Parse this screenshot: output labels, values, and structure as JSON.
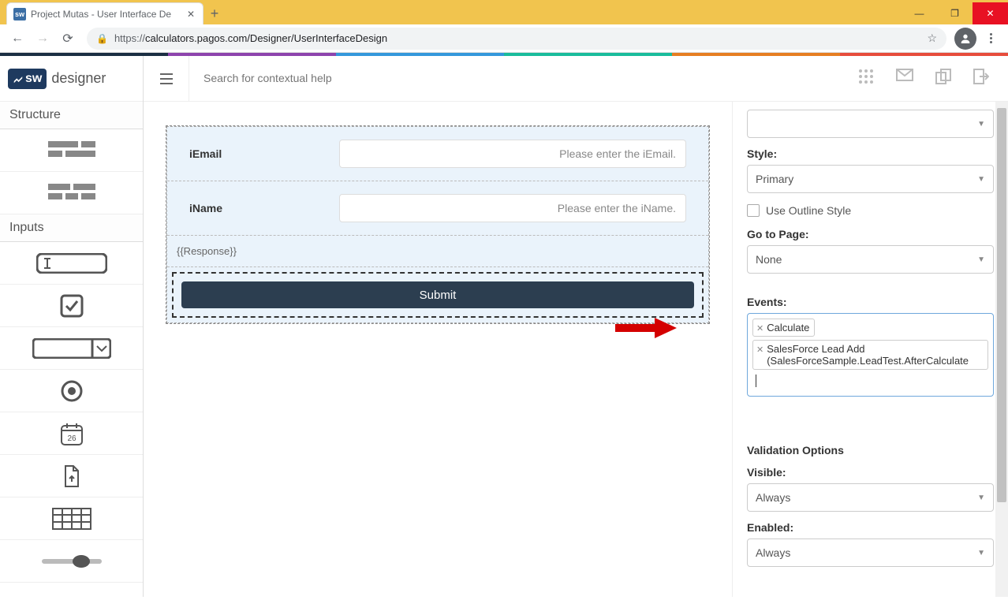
{
  "browser": {
    "tab_title": "Project Mutas - User Interface De",
    "url_proto": "https://",
    "url_rest": "calculators.pagos.com/Designer/UserInterfaceDesign"
  },
  "app": {
    "logo_sw": "sw",
    "logo_text": "designer",
    "search_placeholder": "Search for contextual help"
  },
  "sidebar": {
    "structure_header": "Structure",
    "inputs_header": "Inputs",
    "date_num": "26"
  },
  "form": {
    "iemail_label": "iEmail",
    "iemail_placeholder": "Please enter the iEmail.",
    "iname_label": "iName",
    "iname_placeholder": "Please enter the iName.",
    "response_text": "{{Response}}",
    "submit_label": "Submit"
  },
  "props": {
    "style_label": "Style:",
    "style_value": "Primary",
    "outline_label": "Use Outline Style",
    "gotopage_label": "Go to Page:",
    "gotopage_value": "None",
    "events_label": "Events:",
    "event1": "Calculate",
    "event2_line1": "SalesForce Lead Add",
    "event2_line2": "(SalesForceSample.LeadTest.AfterCalculate",
    "validation_header": "Validation Options",
    "visible_label": "Visible:",
    "visible_value": "Always",
    "enabled_label": "Enabled:",
    "enabled_value": "Always"
  }
}
